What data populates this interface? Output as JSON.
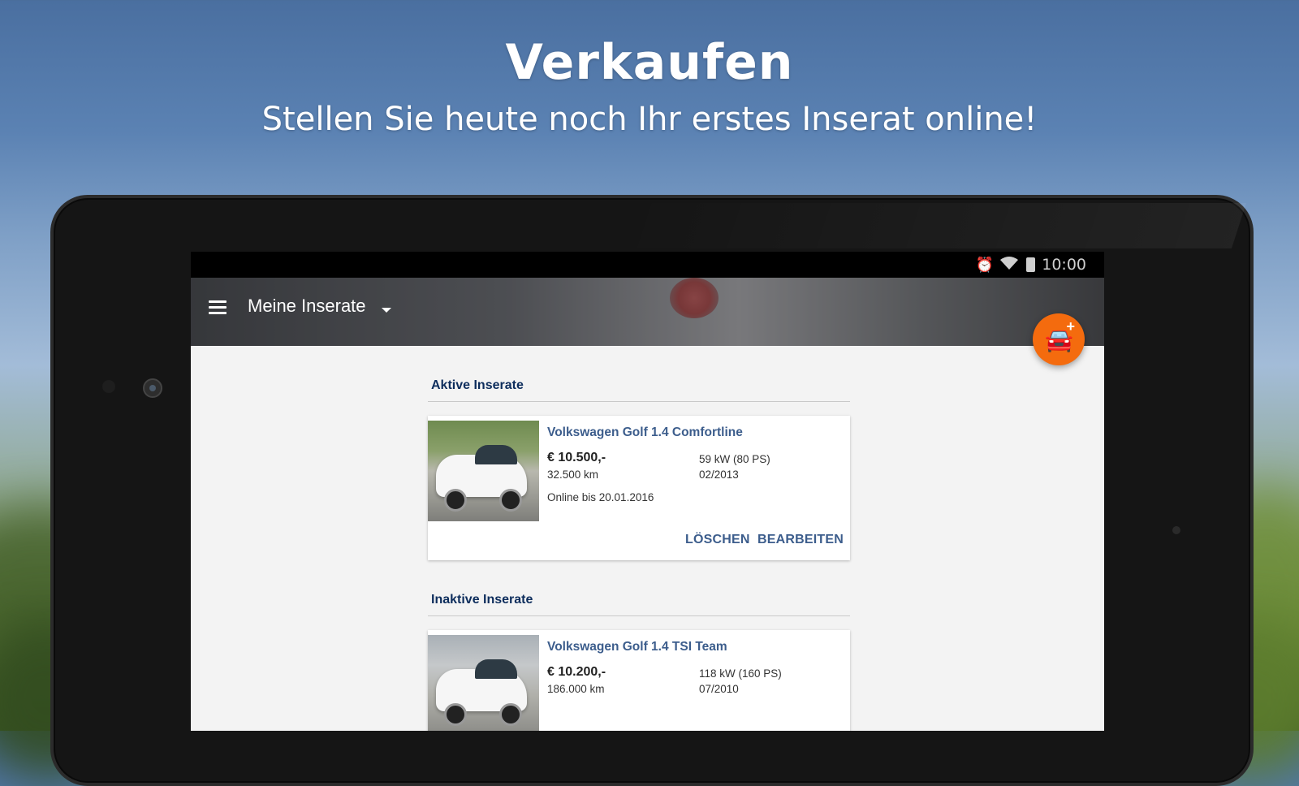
{
  "hero": {
    "title": "Verkaufen",
    "subtitle": "Stellen Sie heute noch Ihr erstes Inserat online!"
  },
  "statusbar": {
    "time": "10:00",
    "icons": [
      "alarm-icon",
      "wifi-icon",
      "battery-icon"
    ]
  },
  "appbar": {
    "title": "Meine Inserate",
    "menu_icon": "menu-icon",
    "dropdown_icon": "dropdown-arrow-icon"
  },
  "fab": {
    "icon": "add-car-icon",
    "color": "#f46b0e"
  },
  "sections": {
    "active": {
      "title": "Aktive Inserate",
      "listing": {
        "title": "Volkswagen Golf 1.4 Comfortline",
        "price": "€ 10.500,-",
        "mileage": "32.500 km",
        "power": "59 kW (80 PS)",
        "registration": "02/2013",
        "online_until": "Online bis 20.01.2016",
        "delete_label": "LÖSCHEN",
        "edit_label": "BEARBEITEN"
      }
    },
    "inactive": {
      "title": "Inaktive Inserate",
      "listing": {
        "title": "Volkswagen Golf 1.4 TSI Team",
        "price": "€ 10.200,-",
        "mileage": "186.000 km",
        "power": "118 kW (160 PS)",
        "registration": "07/2010"
      }
    }
  },
  "colors": {
    "accent": "#f46b0e",
    "link": "#3c5d8c",
    "section_heading": "#0d2d5c"
  }
}
